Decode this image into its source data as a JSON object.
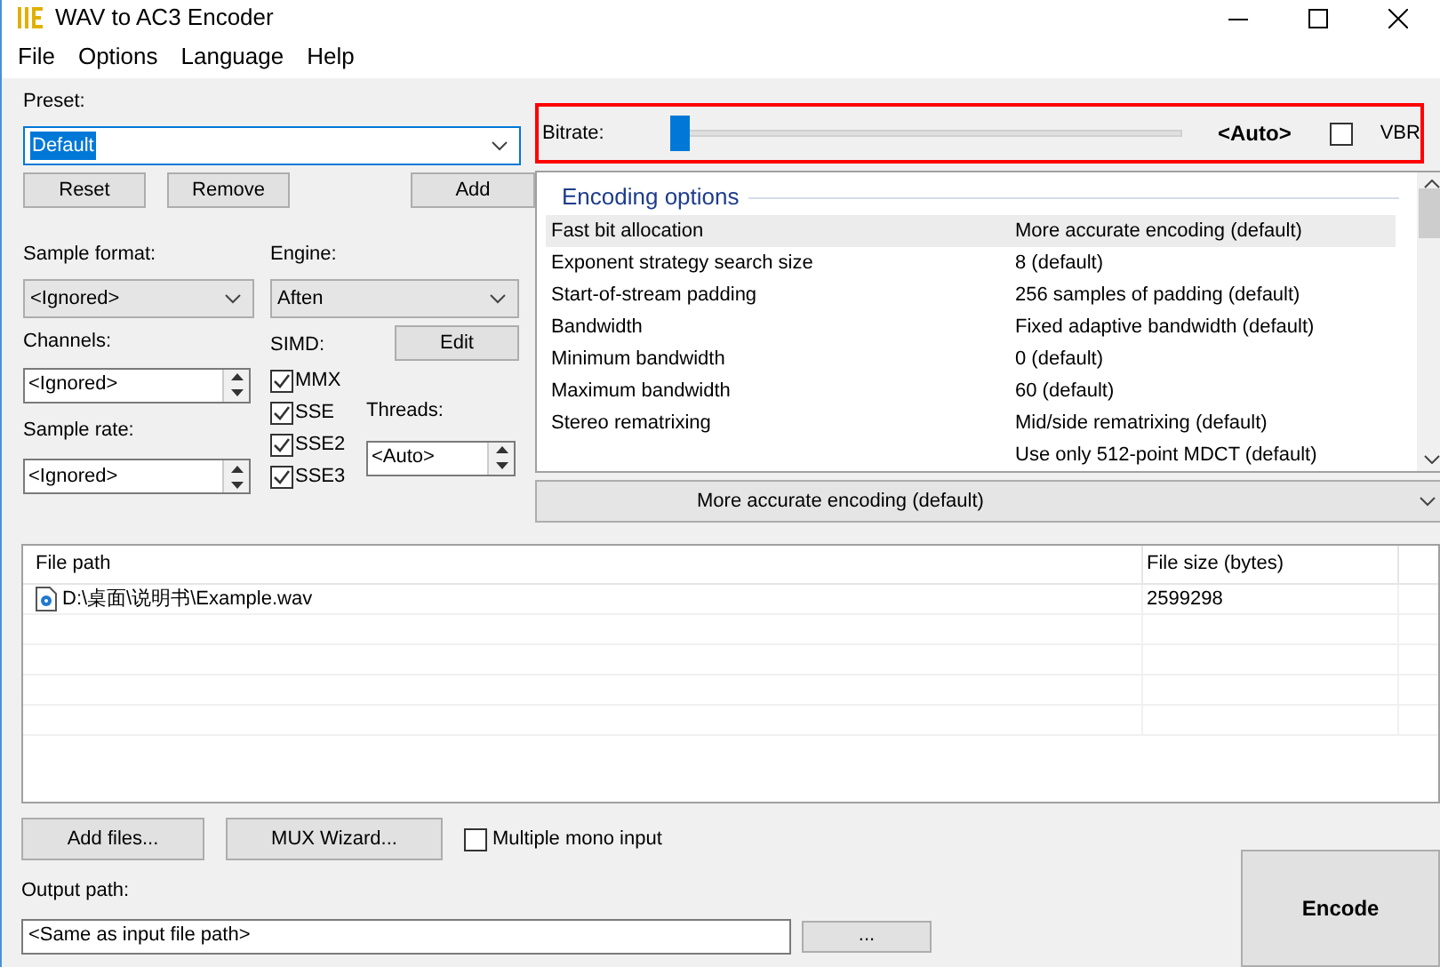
{
  "window": {
    "title": "WAV to AC3 Encoder"
  },
  "menu": [
    "File",
    "Options",
    "Language",
    "Help"
  ],
  "preset": {
    "label": "Preset:",
    "value": "Default",
    "buttons": [
      "Reset",
      "Remove",
      "Add"
    ]
  },
  "sample_format": {
    "label": "Sample format:",
    "value": "<Ignored>"
  },
  "engine": {
    "label": "Engine:",
    "value": "Aften"
  },
  "channels": {
    "label": "Channels:",
    "value": "<Ignored>"
  },
  "simd": {
    "label": "SIMD:",
    "edit_button": "Edit",
    "options": [
      {
        "label": "MMX",
        "checked": true
      },
      {
        "label": "SSE",
        "checked": true
      },
      {
        "label": "SSE2",
        "checked": true
      },
      {
        "label": "SSE3",
        "checked": true
      }
    ]
  },
  "sample_rate": {
    "label": "Sample rate:",
    "value": "<Ignored>"
  },
  "threads": {
    "label": "Threads:",
    "value": "<Auto>"
  },
  "bitrate": {
    "label": "Bitrate:",
    "level": 0,
    "reading": "<Auto>",
    "vbr": {
      "label": "VBR",
      "checked": false
    }
  },
  "encoding_options": {
    "title": "Encoding options",
    "rows": [
      {
        "name": "Fast bit allocation",
        "value": "More accurate encoding (default)",
        "selected": true
      },
      {
        "name": "Exponent strategy search size",
        "value": "8 (default)",
        "selected": false
      },
      {
        "name": "Start-of-stream padding",
        "value": "256 samples of padding (default)",
        "selected": false
      },
      {
        "name": "Bandwidth",
        "value": "Fixed adaptive bandwidth (default)",
        "selected": false
      },
      {
        "name": "Minimum bandwidth",
        "value": "0 (default)",
        "selected": false
      },
      {
        "name": "Maximum bandwidth",
        "value": "60 (default)",
        "selected": false
      },
      {
        "name": "Stereo rematrixing",
        "value": "Mid/side rematrixing (default)",
        "selected": false
      },
      {
        "value": "Use only 512-point MDCT (default)",
        "selected": false
      }
    ]
  },
  "value_field": {
    "value": "More accurate encoding (default)"
  },
  "file_table": {
    "columns": [
      "File path",
      "File size (bytes)"
    ],
    "rows": [
      {
        "path": "D:\\桌面\\说明书\\Example.wav",
        "size": "2599298"
      }
    ]
  },
  "add_files_button": "Add files...",
  "mux_button": "MUX Wizard...",
  "multiple_mono": {
    "label": "Multiple mono input",
    "checked": false
  },
  "output": {
    "label": "Output path:",
    "value": "<Same as input file path>",
    "browse": "..."
  },
  "encode_button": "Encode"
}
